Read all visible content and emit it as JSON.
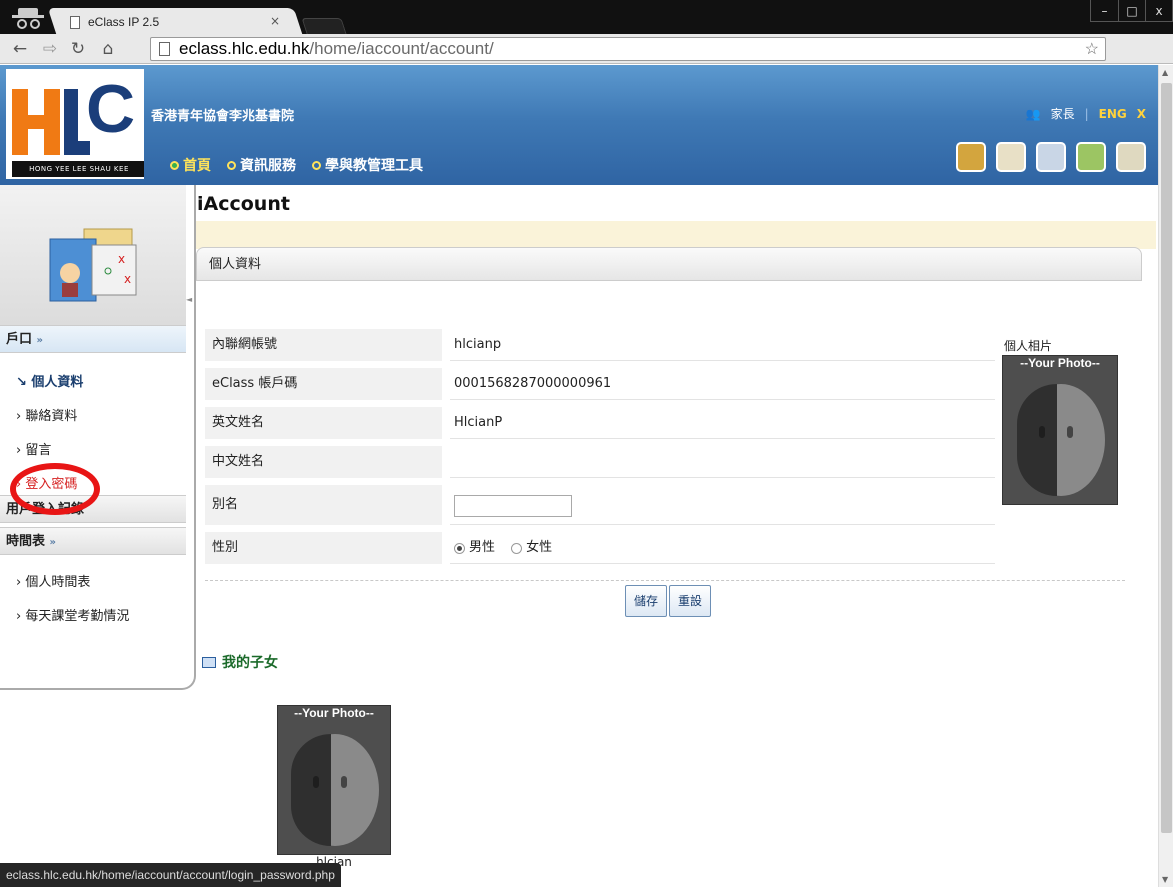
{
  "browser": {
    "tab_title": "eClass IP 2.5",
    "tab_close": "×",
    "url_host": "eclass.hlc.edu.hk",
    "url_path": "/home/iaccount/account/",
    "win_controls": [
      "–",
      "□",
      "x"
    ],
    "status_url": "eclass.hlc.edu.hk/home/iaccount/account/login_password.php"
  },
  "site": {
    "logo_text": "HONG YEE LEE SHAU KEE COLLEGE",
    "school_name": "香港青年協會李兆基書院",
    "user_role": "家長",
    "lang_toggle": "ENG",
    "close_label": "X",
    "nav": {
      "home": "首頁",
      "info": "資訊服務",
      "tools": "學與教管理工具"
    }
  },
  "sidebar": {
    "account_section": "戶口",
    "items": [
      {
        "label": "個人資料",
        "state": "current"
      },
      {
        "label": "聯絡資料"
      },
      {
        "label": "留言"
      },
      {
        "label": "登入密碼",
        "highlighted": true
      }
    ],
    "history_section": "用戶登入記錄",
    "timetable_section": "時間表",
    "timetable_items": [
      "個人時間表",
      "每天課堂考勤情況"
    ]
  },
  "main": {
    "app_title": "iAccount",
    "panel_title": "個人資料",
    "fields": [
      {
        "label": "內聯網帳號",
        "value": "hlcianp"
      },
      {
        "label": "eClass 帳戶碼",
        "value": "0001568287000000961"
      },
      {
        "label": "英文姓名",
        "value": "HlcianP"
      },
      {
        "label": "中文姓名",
        "value": ""
      },
      {
        "label": "別名",
        "value": ""
      },
      {
        "label": "性別",
        "value": ""
      }
    ],
    "gender_male": "男性",
    "gender_female": "女性",
    "photo_label": "個人相片",
    "photo_placeholder": "--Your Photo--",
    "save_button": "儲存",
    "reset_button": "重設",
    "my_children": "我的子女",
    "child_name": "hlcian"
  }
}
